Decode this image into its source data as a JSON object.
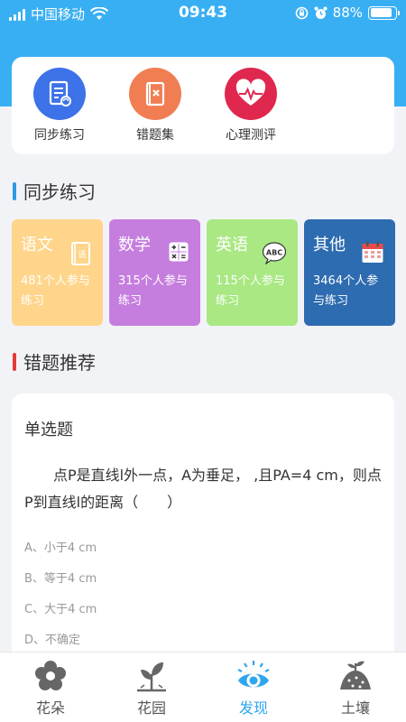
{
  "status_bar": {
    "carrier": "中国移动",
    "time": "09:43",
    "battery": "88%",
    "battery_level": 0.88
  },
  "quick_actions": [
    {
      "label": "同步练习",
      "icon": "practice-icon",
      "color": "#3d72e8"
    },
    {
      "label": "错题集",
      "icon": "mistake-book-icon",
      "color": "#f07e52"
    },
    {
      "label": "心理测评",
      "icon": "heart-pulse-icon",
      "color": "#e0284f"
    }
  ],
  "sync_section": {
    "title": "同步练习",
    "accent": "#2d9ae8"
  },
  "subjects": [
    {
      "name": "语文",
      "count": "481个人参与练习",
      "color": "#fed58a",
      "icon": "book-icon"
    },
    {
      "name": "数学",
      "count": "315个人参与练习",
      "color": "#c57ede",
      "icon": "calculator-icon"
    },
    {
      "name": "英语",
      "count": "115个人参与练习",
      "color": "#a9e882",
      "icon": "abc-icon"
    },
    {
      "name": "其他",
      "count": "3464个人参与练习",
      "color": "#2d6cb0",
      "icon": "calendar-icon"
    }
  ],
  "mistake_section": {
    "title": "错题推荐",
    "accent": "#e33a3a"
  },
  "question": {
    "type": "单选题",
    "text": "点P是直线l外一点，A为垂足，  ,且PA=4 cm，则点P到直线l的距离（　　）",
    "options": [
      "A、小于4 cm",
      "B、等于4 cm",
      "C、大于4 cm",
      "D、不确定"
    ]
  },
  "tabs": [
    {
      "label": "花朵",
      "icon": "flower-icon",
      "active": false
    },
    {
      "label": "花园",
      "icon": "sprout-icon",
      "active": false
    },
    {
      "label": "发现",
      "icon": "eye-icon",
      "active": true
    },
    {
      "label": "土壤",
      "icon": "soil-icon",
      "active": false
    }
  ]
}
